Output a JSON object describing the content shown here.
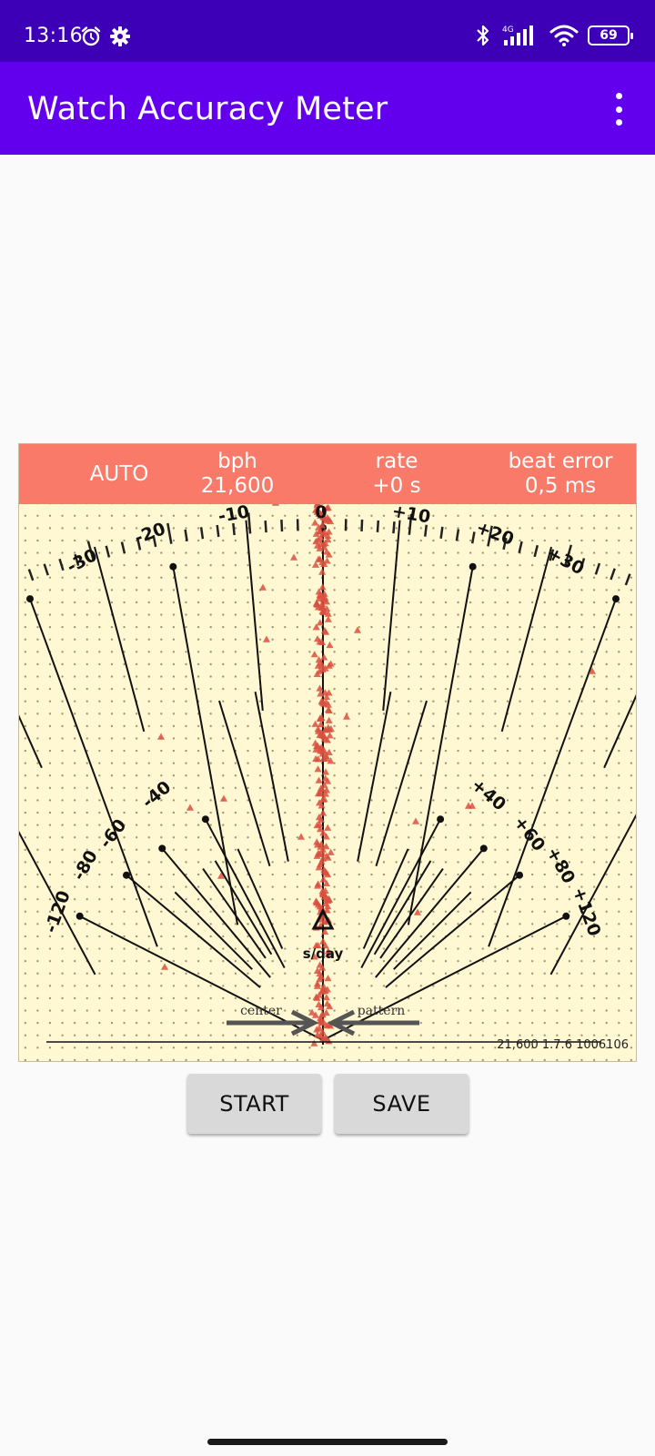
{
  "status_bar": {
    "time": "13:16",
    "network": "4G",
    "battery": "69"
  },
  "app_bar": {
    "title": "Watch Accuracy Meter"
  },
  "meter": {
    "header": {
      "mode": "AUTO",
      "bph_label": "bph",
      "bph_value": "21,600",
      "rate_label": "rate",
      "rate_value": "+0 s",
      "beat_error_label": "beat error",
      "beat_error_value": "0,5 ms"
    },
    "scale_labels": [
      "-120",
      "-80",
      "-60",
      "-40",
      "-30",
      "-20",
      "-10",
      "0",
      "+10",
      "+20",
      "+30",
      "+40",
      "+60",
      "+80",
      "+120"
    ],
    "unit_label": "s/day",
    "center_label": "center",
    "pattern_label": "pattern",
    "footer_info": "21,600 1.7.6 1006106",
    "colors": {
      "header_bg": "#f97a68",
      "panel_bg": "#fff8d2",
      "marker": "#d9503e"
    }
  },
  "buttons": {
    "start": "START",
    "save": "SAVE"
  }
}
